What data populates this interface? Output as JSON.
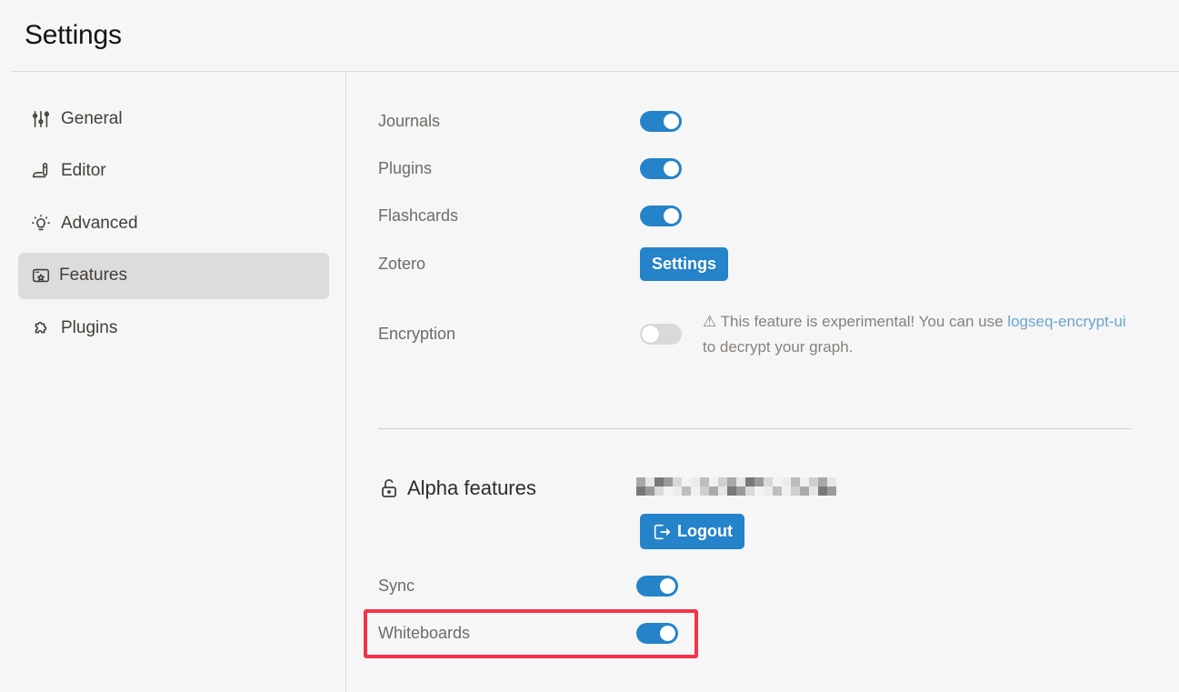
{
  "header": {
    "title": "Settings"
  },
  "sidebar": {
    "items": [
      {
        "label": "General",
        "icon": "sliders-icon",
        "active": false
      },
      {
        "label": "Editor",
        "icon": "editor-icon",
        "active": false
      },
      {
        "label": "Advanced",
        "icon": "lightbulb-icon",
        "active": false
      },
      {
        "label": "Features",
        "icon": "features-icon",
        "active": true
      },
      {
        "label": "Plugins",
        "icon": "puzzle-icon",
        "active": false
      }
    ]
  },
  "features": {
    "journals": {
      "label": "Journals",
      "enabled": true
    },
    "plugins": {
      "label": "Plugins",
      "enabled": true
    },
    "flashcards": {
      "label": "Flashcards",
      "enabled": true
    },
    "zotero": {
      "label": "Zotero",
      "button_label": "Settings"
    },
    "encryption": {
      "label": "Encryption",
      "enabled": false,
      "note_prefix": "⚠ This feature is experimental! You can use ",
      "note_link": "logseq-encrypt-ui",
      "note_suffix": " to decrypt your graph."
    }
  },
  "alpha": {
    "title": "Alpha features",
    "account": "[redacted]",
    "logout_label": "Logout",
    "sync": {
      "label": "Sync",
      "enabled": true
    },
    "whiteboards": {
      "label": "Whiteboards",
      "enabled": true
    }
  },
  "colors": {
    "accent": "#2483c9",
    "link": "#6ba4cf",
    "highlight": "#f5334a",
    "active_nav": "#dcdcdc",
    "background": "#f6f6f6"
  }
}
